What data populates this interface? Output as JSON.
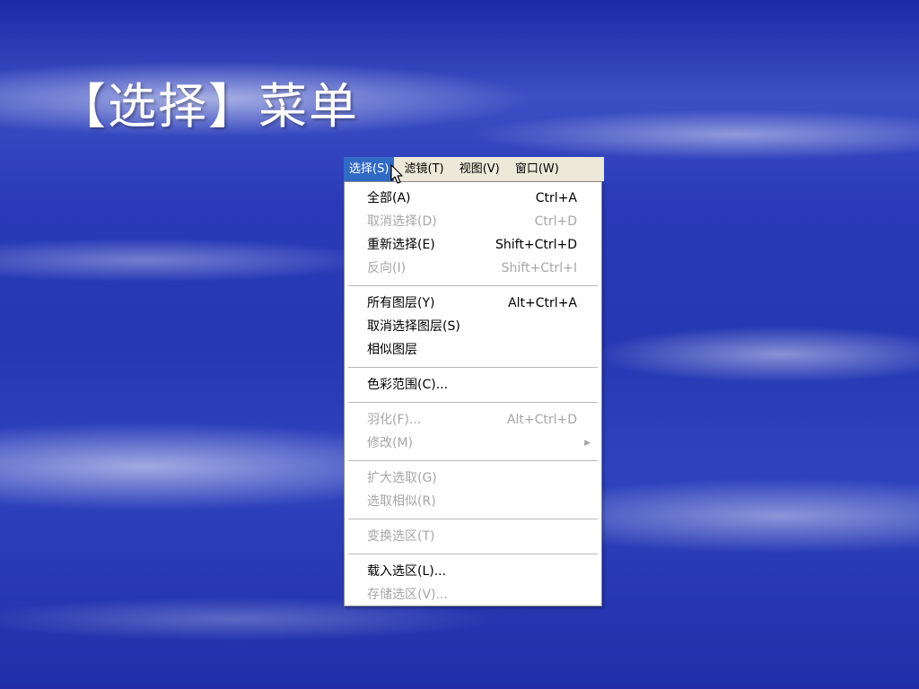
{
  "slide": {
    "title": "【选择】菜单"
  },
  "menubar": {
    "items": [
      {
        "label": "选择(S)",
        "active": true
      },
      {
        "label": "滤镜(T)",
        "active": false
      },
      {
        "label": "视图(V)",
        "active": false
      },
      {
        "label": "窗口(W)",
        "active": false
      }
    ]
  },
  "menu": {
    "items": [
      {
        "label": "全部(A)",
        "shortcut": "Ctrl+A"
      },
      {
        "label": "取消选择(D)",
        "shortcut": "Ctrl+D"
      },
      {
        "label": "重新选择(E)",
        "shortcut": "Shift+Ctrl+D"
      },
      {
        "label": "反向(I)",
        "shortcut": "Shift+Ctrl+I"
      },
      {
        "label": "所有图层(Y)",
        "shortcut": "Alt+Ctrl+A"
      },
      {
        "label": "取消选择图层(S)"
      },
      {
        "label": "相似图层"
      },
      {
        "label": "色彩范围(C)..."
      },
      {
        "label": "羽化(F)...",
        "shortcut": "Alt+Ctrl+D"
      },
      {
        "label": "修改(M)",
        "submenu_arrow": "▶"
      },
      {
        "label": "扩大选取(G)"
      },
      {
        "label": "选取相似(R)"
      },
      {
        "label": "变换选区(T)"
      },
      {
        "label": "载入选区(L)..."
      },
      {
        "label": "存储选区(V)..."
      }
    ]
  },
  "colors": {
    "highlight": "#316ac5",
    "disabled_text": "#a6a6a6"
  },
  "icons": {
    "cursor": "arrow-cursor-icon",
    "submenu": "submenu-arrow-icon"
  }
}
